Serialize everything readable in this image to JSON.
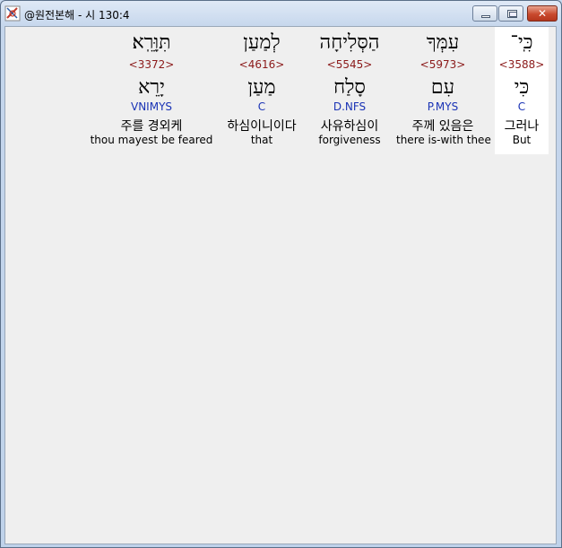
{
  "window": {
    "title": "@원전본해 - 시 130:4",
    "icon": "bible-app-icon",
    "controls": {
      "minimize": "minimize-icon",
      "maximize": "maximize-icon",
      "close": "close-icon"
    }
  },
  "words": [
    {
      "hebrew": "כִּֽי־",
      "strong": "<3588>",
      "root": "כִּי",
      "morph": "C",
      "korean": "그러나",
      "english": "But",
      "highlighted": true
    },
    {
      "hebrew": "עִמְּךָ",
      "strong": "<5973>",
      "root": "עִם",
      "morph": "P.MYS",
      "korean": "주께 있음은",
      "english": "there is-with thee",
      "highlighted": false
    },
    {
      "hebrew": "הַסְּלִיחָה",
      "strong": "<5545>",
      "root": "סָלַח",
      "morph": "D.NFS",
      "korean": "사유하심이",
      "english": "forgiveness",
      "highlighted": false
    },
    {
      "hebrew": "לְמַעַן",
      "strong": "<4616>",
      "root": "מַעַן",
      "morph": "C",
      "korean": "하심이니이다",
      "english": "that",
      "highlighted": false
    },
    {
      "hebrew": "תִּוָּרֵֽא׃",
      "strong": "<3372>",
      "root": "יָרֵא",
      "morph": "VNIMYS",
      "korean": "주를 경외케",
      "english": "thou mayest be feared",
      "highlighted": false
    }
  ]
}
